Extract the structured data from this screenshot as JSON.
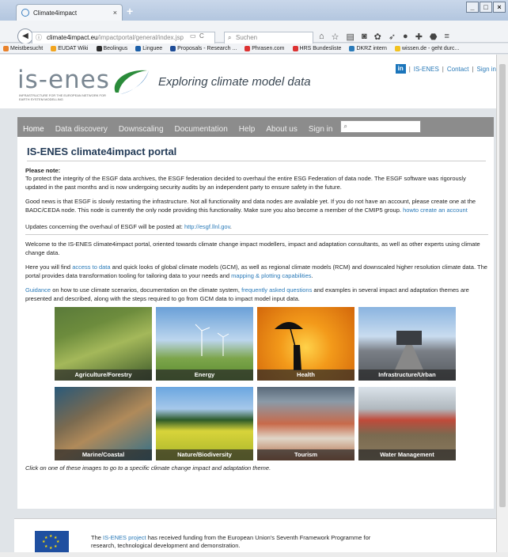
{
  "browser": {
    "tab_title": "Climate4impact",
    "tab_close": "×",
    "new_tab": "+",
    "url_host": "climate4impact.eu",
    "url_path": "/impactportal/general/index.jsp",
    "search_placeholder": "Suchen",
    "window_buttons": [
      "_",
      "□",
      "×"
    ],
    "bookmarks": [
      {
        "label": "Meistbesucht",
        "color": "#e9822b"
      },
      {
        "label": "EUDAT Wiki",
        "color": "#f2a51f"
      },
      {
        "label": "Beolingus",
        "color": "#2c2c2c"
      },
      {
        "label": "Linguee",
        "color": "#1b5fa8"
      },
      {
        "label": "Proposals - Research ...",
        "color": "#1e4c97"
      },
      {
        "label": "Phrasen.com",
        "color": "#d33"
      },
      {
        "label": "HRS Bundesliste",
        "color": "#d33"
      },
      {
        "label": "DKRZ intern",
        "color": "#2a7ab8"
      },
      {
        "label": "wissen.de - geht durc...",
        "color": "#f2c21f"
      }
    ]
  },
  "site": {
    "logo": "is-enes",
    "logo_sub": "INFRASTRUCTURE FOR THE EUROPEAN NETWORK FOR EARTH SYSTEM MODELLING",
    "tagline": "Exploring climate model data",
    "top_links": [
      "IS-ENES",
      "Contact",
      "Sign in"
    ],
    "linkedin": "in",
    "menu": [
      "Home",
      "Data discovery",
      "Downscaling",
      "Documentation",
      "Help",
      "About us",
      "Sign in"
    ]
  },
  "content": {
    "title": "IS-ENES climate4impact portal",
    "please_note": "Please note:",
    "p1": "To protect the integrity of the ESGF data archives, the ESGF federation decided to overhaul the entire ESG Federation of data node. The ESGF software was rigorously updated in the past months and is now undergoing security audits by an independent party to ensure safety in the future.",
    "p2a": "Good news is that ESGF is slowly restarting the infrastructure. Not all functionality and data nodes are available yet. If you do not have an account, please create one at the BADC/CEDA node. This node is currently the only node providing this functionality. Make sure you also become a member of the CMIP5 group.",
    "p2link": "howto create an account",
    "p3": "Updates concerning the overhaul of ESGF will be posted at:",
    "p3link": "http://esgf.llnl.gov",
    "p3end": ".",
    "p4": "Welcome to the IS-ENES climate4impact portal, oriented towards climate change impact modellers, impact and adaptation consultants, as well as other experts using climate change data.",
    "p5a": "Here you will find",
    "p5link1": "access to data",
    "p5b": "and quick looks of global climate models (GCM), as well as regional climate models (RCM) and downscaled higher resolution climate data. The portal provides data transformation tooling for tailoring data to your needs and",
    "p5link2": "mapping & plotting capabilities",
    "p5c": ".",
    "p6link1": "Guidance",
    "p6a": "on how to use climate scenarios, documentation on the climate system,",
    "p6link2": "frequently asked questions",
    "p6b": "and examples in several impact and adaptation themes are presented and described, along with the steps required to go from GCM data to impact model input data.",
    "tiles": [
      {
        "label": "Agriculture/Forestry"
      },
      {
        "label": "Energy"
      },
      {
        "label": "Health"
      },
      {
        "label": "Infrastructure/Urban"
      },
      {
        "label": "Marine/Coastal"
      },
      {
        "label": "Nature/Biodiversity"
      },
      {
        "label": "Tourism"
      },
      {
        "label": "Water Management"
      }
    ],
    "caption": "Click on one of these images to go to a specific climate change impact and adaptation theme."
  },
  "footer": {
    "text_a": "The",
    "link": "IS-ENES project",
    "text_b": "has received funding from the European Union's Seventh Framework Programme for research, technological development and demonstration."
  }
}
